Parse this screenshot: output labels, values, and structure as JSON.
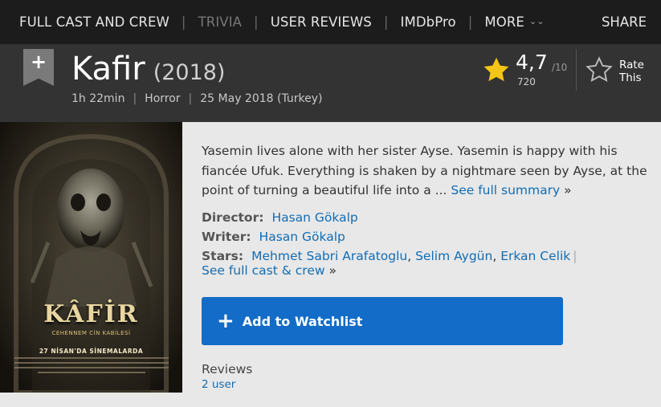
{
  "nav": {
    "items": [
      "FULL CAST AND CREW",
      "TRIVIA",
      "USER REVIEWS",
      "IMDbPro",
      "MORE"
    ],
    "share": "SHARE"
  },
  "movie": {
    "title": "Kafir",
    "year": "(2018)",
    "runtime": "1h 22min",
    "genre": "Horror",
    "release": "25 May 2018 (Turkey)"
  },
  "rating": {
    "value": "4,7",
    "best": "/10",
    "count": "720",
    "rate_this_line1": "Rate",
    "rate_this_line2": "This"
  },
  "poster": {
    "title": "KÂFİR",
    "tagline": "CEHENNEM CİN KABİLESİ",
    "date": "27 NİSAN'DA SİNEMALARDA"
  },
  "summary": {
    "text": "Yasemin lives alone with her sister Ayse. Yasemin is happy with his fiancée Ufuk. Everything is shaken by a nightmare seen by Ayse, at the point of turning a beautiful life into a ...",
    "link": "See full summary",
    "raquo": "»"
  },
  "credits": {
    "director_label": "Director:",
    "director": "Hasan Gökalp",
    "writer_label": "Writer:",
    "writer": "Hasan Gökalp",
    "stars_label": "Stars:",
    "stars": [
      "Mehmet Sabri Arafatoglu",
      "Selim Aygün",
      "Erkan Celik"
    ],
    "full_cast": "See full cast & crew",
    "full_cast_raquo": "»"
  },
  "watchlist": {
    "plus": "+",
    "label": "Add to Watchlist"
  },
  "reviews": {
    "label": "Reviews",
    "count": "2 user"
  },
  "colors": {
    "link": "#136cb2",
    "button": "#136cc7",
    "star": "#f5c518"
  }
}
